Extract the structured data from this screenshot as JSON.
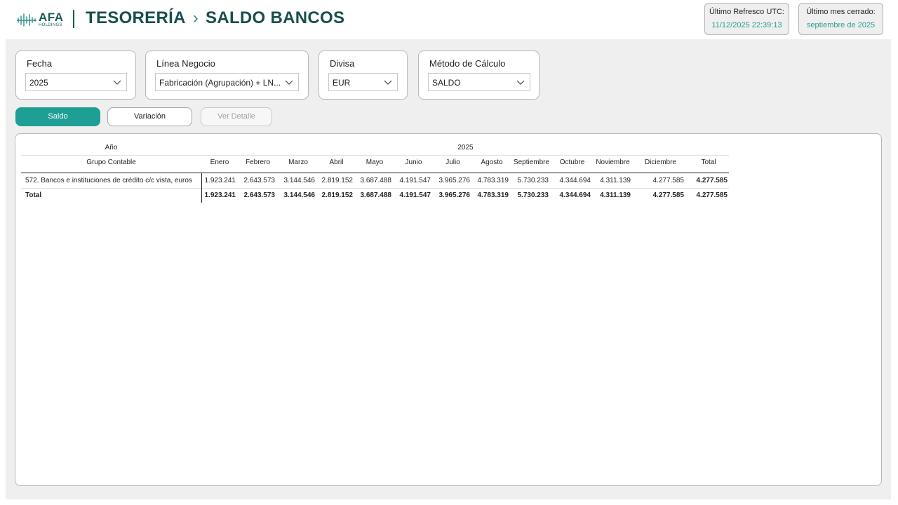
{
  "header": {
    "logo_main": "AFA",
    "logo_sub": "HOLDINGS",
    "section": "TESORERÍA",
    "page": "SALDO BANCOS",
    "refresh_label": "Último Refresco UTC:",
    "refresh_value": "11/12/2025 22:39:13",
    "closed_label": "Último mes cerrado:",
    "closed_value": "septiembre de 2025"
  },
  "filters": {
    "fecha": {
      "label": "Fecha",
      "value": "2025"
    },
    "linea": {
      "label": "Línea Negocio",
      "value": "Fabricación (Agrupación) + LN..."
    },
    "divisa": {
      "label": "Divisa",
      "value": "EUR"
    },
    "metodo": {
      "label": "Método de Cálculo",
      "value": "SALDO"
    }
  },
  "buttons": {
    "saldo": "Saldo",
    "variacion": "Variación",
    "detalle": "Ver Detalle"
  },
  "colors": {
    "accent": "#1f9e95",
    "title": "#174f4b",
    "canvas": "#efefef"
  },
  "icons": {
    "logo": "afa-waveform-icon",
    "breadcrumb": "chevron-right-icon",
    "dropdown": "chevron-down-icon"
  },
  "matrix": {
    "year_header_label": "Año",
    "year": "2025",
    "row_header_label": "Grupo Contable",
    "months": [
      "Enero",
      "Febrero",
      "Marzo",
      "Abril",
      "Mayo",
      "Junio",
      "Julio",
      "Agosto",
      "Septiembre",
      "Octubre",
      "Noviembre",
      "Diciembre",
      "Total"
    ],
    "rows": [
      {
        "label": "572. Bancos e instituciones de crédito c/c vista, euros",
        "values": [
          "1.923.241",
          "2.643.573",
          "3.144.546",
          "2.819.152",
          "3.687.488",
          "4.191.547",
          "3.965.276",
          "4.783.319",
          "5.730.233",
          "4.344.694",
          "4.311.139",
          "4.277.585",
          "4.277.585"
        ]
      },
      {
        "label": "Total",
        "values": [
          "1.923.241",
          "2.643.573",
          "3.144.546",
          "2.819.152",
          "3.687.488",
          "4.191.547",
          "3.965.276",
          "4.783.319",
          "5.730.233",
          "4.344.694",
          "4.311.139",
          "4.277.585",
          "4.277.585"
        ]
      }
    ]
  }
}
